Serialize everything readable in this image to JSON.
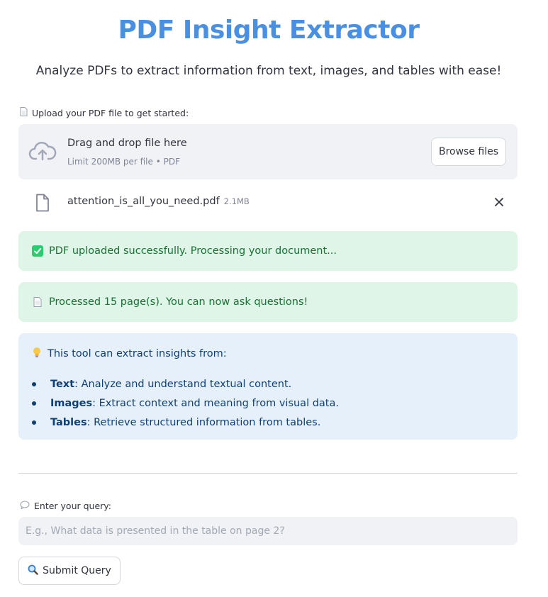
{
  "header": {
    "title": "PDF Insight Extractor",
    "subtitle": "Analyze PDFs to extract information from text, images, and tables with ease!"
  },
  "upload": {
    "label": "Upload your PDF file to get started:",
    "label_icon": "page-icon",
    "dropzone_title": "Drag and drop file here",
    "dropzone_limit": "Limit 200MB per file • PDF",
    "dropzone_icon": "cloud-upload-icon",
    "browse_label": "Browse files",
    "file": {
      "name": "attention_is_all_you_need.pdf",
      "size": "2.1MB",
      "icon": "file-icon"
    }
  },
  "alerts": [
    {
      "icon": "check-box-icon",
      "text": "PDF uploaded successfully. Processing your document..."
    },
    {
      "icon": "page-icon",
      "text": "Processed 15 page(s). You can now ask questions!"
    }
  ],
  "info": {
    "icon": "lightbulb-icon",
    "heading": "This tool can extract insights from:",
    "items": [
      {
        "term": "Text",
        "desc": ": Analyze and understand textual content."
      },
      {
        "term": "Images",
        "desc": ": Extract context and meaning from visual data."
      },
      {
        "term": "Tables",
        "desc": ": Retrieve structured information from tables."
      }
    ]
  },
  "query": {
    "label": "Enter your query:",
    "label_icon": "speech-bubble-icon",
    "placeholder": "E.g., What data is presented in the table on page 2?",
    "value": "",
    "submit_label": "Submit Query",
    "submit_icon": "magnifier-icon"
  },
  "colors": {
    "title": "#4a90e2",
    "success_bg": "#dff5e7",
    "success_text": "#177233",
    "info_bg": "#e6f0fb",
    "info_text": "#0f3f73"
  }
}
